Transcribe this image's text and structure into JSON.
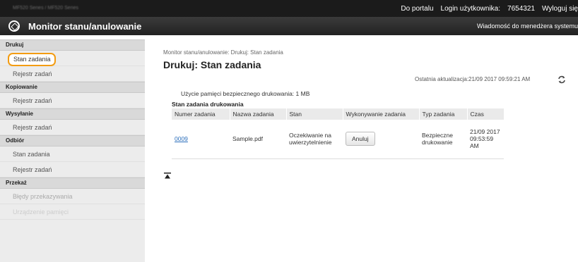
{
  "topbar": {
    "model": "MF520 Series / MF520 Series",
    "portal_link": "Do portalu",
    "login_label": "Login użytkownika:",
    "user_id": "7654321",
    "logout": "Wyloguj się"
  },
  "header": {
    "app_title": "Monitor stanu/anulowanie",
    "message_link": "Wiadomość do menedżera systemu"
  },
  "sidebar": {
    "sections": [
      {
        "title": "Drukuj",
        "items": [
          "Stan zadania",
          "Rejestr zadań"
        ]
      },
      {
        "title": "Kopiowanie",
        "items": [
          "Rejestr zadań"
        ]
      },
      {
        "title": "Wysyłanie",
        "items": [
          "Rejestr zadań"
        ]
      },
      {
        "title": "Odbiór",
        "items": [
          "Stan zadania",
          "Rejestr zadań"
        ]
      },
      {
        "title": "Przekaż",
        "items": [
          "Błędy przekazywania",
          "Urządzenie pamięci"
        ]
      }
    ]
  },
  "main": {
    "breadcrumb": "Monitor stanu/anulowanie: Drukuj: Stan zadania",
    "page_title": "Drukuj: Stan zadania",
    "last_update": "Ostatnia aktualizacja:21/09 2017 09:59:21 AM",
    "memory_usage": "Użycie pamięci bezpiecznego drukowania:   1 MB",
    "section_title": "Stan zadania drukowania",
    "table": {
      "headers": [
        "Numer zadania",
        "Nazwa zadania",
        "Stan",
        "Wykonywanie zadania",
        "Typ zadania",
        "Czas"
      ],
      "rows": [
        {
          "job_number": "0009",
          "job_name": "Sample.pdf",
          "status": "Oczekiwanie na uwierzytelnienie",
          "action": "Anuluj",
          "type": "Bezpieczne drukowanie",
          "time": "21/09 2017 09:53:59 AM"
        }
      ]
    }
  }
}
